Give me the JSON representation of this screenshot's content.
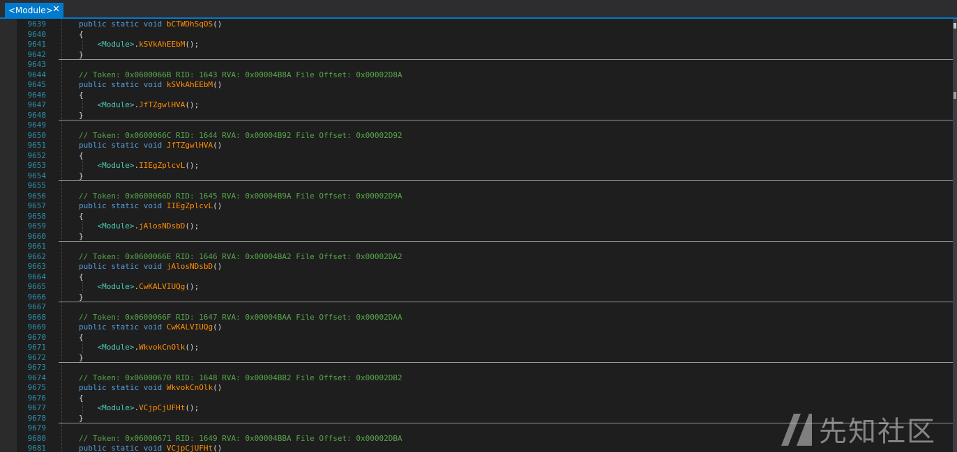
{
  "tab": {
    "label": "<Module>",
    "close_glyph": "✕"
  },
  "watermark": {
    "text": "先知社区",
    "icon": "xianzhi-logo-icon"
  },
  "lines": [
    {
      "n": "9639",
      "kind": "sig",
      "method": "bCTWDhSqOS"
    },
    {
      "n": "9640",
      "kind": "open"
    },
    {
      "n": "9641",
      "kind": "call",
      "target": "kSVkAhEEbM"
    },
    {
      "n": "9642",
      "kind": "close"
    },
    {
      "n": "9643",
      "kind": "blank"
    },
    {
      "n": "9644",
      "kind": "comment",
      "text": "// Token: 0x0600066B RID: 1643 RVA: 0x00004B8A File Offset: 0x00002D8A"
    },
    {
      "n": "9645",
      "kind": "sig",
      "method": "kSVkAhEEbM"
    },
    {
      "n": "9646",
      "kind": "open"
    },
    {
      "n": "9647",
      "kind": "call",
      "target": "JfTZgwlHVA"
    },
    {
      "n": "9648",
      "kind": "close"
    },
    {
      "n": "9649",
      "kind": "blank"
    },
    {
      "n": "9650",
      "kind": "comment",
      "text": "// Token: 0x0600066C RID: 1644 RVA: 0x00004B92 File Offset: 0x00002D92"
    },
    {
      "n": "9651",
      "kind": "sig",
      "method": "JfTZgwlHVA"
    },
    {
      "n": "9652",
      "kind": "open"
    },
    {
      "n": "9653",
      "kind": "call",
      "target": "IIEgZplcvL"
    },
    {
      "n": "9654",
      "kind": "close"
    },
    {
      "n": "9655",
      "kind": "blank"
    },
    {
      "n": "9656",
      "kind": "comment",
      "text": "// Token: 0x0600066D RID: 1645 RVA: 0x00004B9A File Offset: 0x00002D9A"
    },
    {
      "n": "9657",
      "kind": "sig",
      "method": "IIEgZplcvL"
    },
    {
      "n": "9658",
      "kind": "open"
    },
    {
      "n": "9659",
      "kind": "call",
      "target": "jAlosNDsbD"
    },
    {
      "n": "9660",
      "kind": "close"
    },
    {
      "n": "9661",
      "kind": "blank"
    },
    {
      "n": "9662",
      "kind": "comment",
      "text": "// Token: 0x0600066E RID: 1646 RVA: 0x00004BA2 File Offset: 0x00002DA2"
    },
    {
      "n": "9663",
      "kind": "sig",
      "method": "jAlosNDsbD"
    },
    {
      "n": "9664",
      "kind": "open"
    },
    {
      "n": "9665",
      "kind": "call",
      "target": "CwKALVIUQg"
    },
    {
      "n": "9666",
      "kind": "close"
    },
    {
      "n": "9667",
      "kind": "blank"
    },
    {
      "n": "9668",
      "kind": "comment",
      "text": "// Token: 0x0600066F RID: 1647 RVA: 0x00004BAA File Offset: 0x00002DAA"
    },
    {
      "n": "9669",
      "kind": "sig",
      "method": "CwKALVIUQg"
    },
    {
      "n": "9670",
      "kind": "open"
    },
    {
      "n": "9671",
      "kind": "call",
      "target": "WkvokCnOlk"
    },
    {
      "n": "9672",
      "kind": "close"
    },
    {
      "n": "9673",
      "kind": "blank"
    },
    {
      "n": "9674",
      "kind": "comment",
      "text": "// Token: 0x06000670 RID: 1648 RVA: 0x00004BB2 File Offset: 0x00002DB2"
    },
    {
      "n": "9675",
      "kind": "sig",
      "method": "WkvokCnOlk"
    },
    {
      "n": "9676",
      "kind": "open"
    },
    {
      "n": "9677",
      "kind": "call",
      "target": "VCjpCjUFHt"
    },
    {
      "n": "9678",
      "kind": "close"
    },
    {
      "n": "9679",
      "kind": "blank"
    },
    {
      "n": "9680",
      "kind": "comment",
      "text": "// Token: 0x06000671 RID: 1649 RVA: 0x00004BBA File Offset: 0x00002DBA"
    },
    {
      "n": "9681",
      "kind": "sig",
      "method": "VCjpCjUFHt"
    }
  ],
  "syntax": {
    "modifiers": "public static void",
    "module_type": "<Module>",
    "open_brace": "{",
    "close_brace": "}"
  },
  "colors": {
    "accent": "#007acc",
    "keyword": "#569cd6",
    "identifier": "#ff8c00",
    "type": "#4ec9b0",
    "comment": "#57a64a",
    "line_number": "#2b91af",
    "background": "#1e1e1e"
  }
}
